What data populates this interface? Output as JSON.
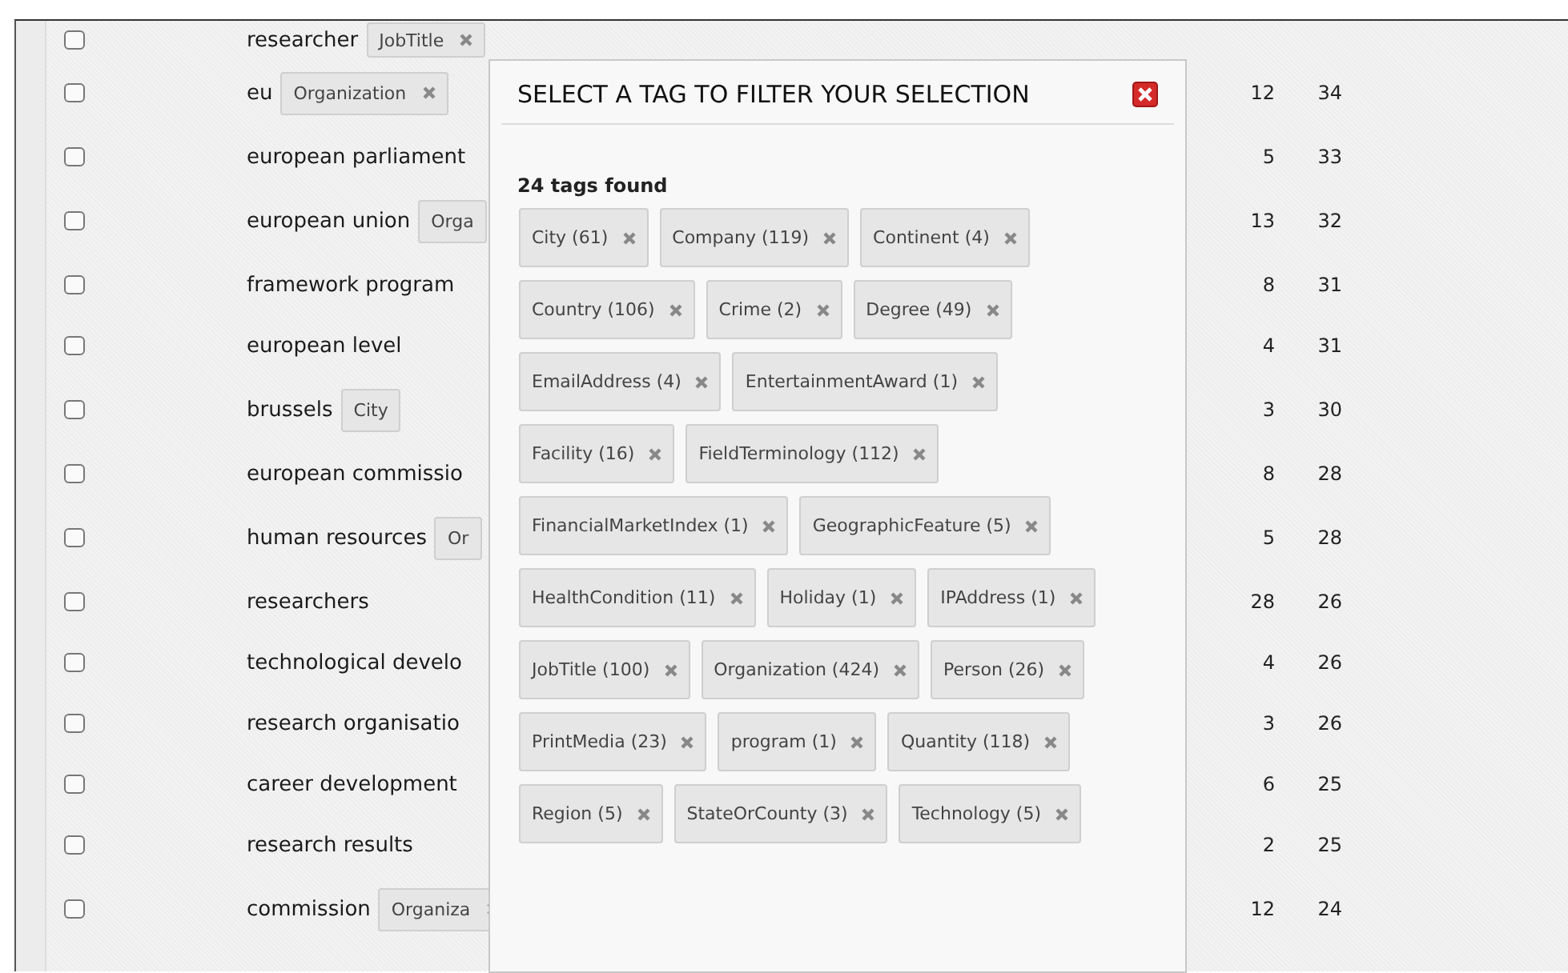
{
  "terms": [
    {
      "term": "researcher",
      "checked": false,
      "tags": [
        "JobTitle"
      ]
    },
    {
      "term": "eu",
      "checked": false,
      "tags": [
        "Organization"
      ],
      "count_1": "12",
      "count_2": "34"
    },
    {
      "term": "european parliament",
      "checked": false,
      "count_1": "5",
      "count_2": "33"
    },
    {
      "term": "european union",
      "checked": false,
      "tags": [
        "Orga"
      ],
      "count_1": "13",
      "count_2": "32"
    },
    {
      "term": "framework program",
      "checked": false,
      "count_1": "8",
      "count_2": "31"
    },
    {
      "term": "european level",
      "checked": false,
      "count_1": "4",
      "count_2": "31"
    },
    {
      "term": "brussels",
      "checked": false,
      "tags": [
        "City"
      ],
      "count_1": "3",
      "count_2": "30"
    },
    {
      "term": "european commissio",
      "checked": false,
      "count_1": "8",
      "count_2": "28"
    },
    {
      "term": "human resources",
      "checked": false,
      "tags": [
        "Or"
      ],
      "count_1": "5",
      "count_2": "28"
    },
    {
      "term": "researchers",
      "checked": false,
      "count_1": "28",
      "count_2": "26"
    },
    {
      "term": "technological develo",
      "checked": false,
      "count_1": "4",
      "count_2": "26"
    },
    {
      "term": "research organisatio",
      "checked": false,
      "count_1": "3",
      "count_2": "26"
    },
    {
      "term": "career development",
      "checked": false,
      "count_1": "6",
      "count_2": "25"
    },
    {
      "term": "research results",
      "checked": false,
      "count_1": "2",
      "count_2": "25"
    },
    {
      "term": "commission",
      "checked": false,
      "tags": [
        "Organiza"
      ],
      "count_1": "12",
      "count_2": "24"
    }
  ],
  "dialog": {
    "title": "SELECT A TAG TO FILTER YOUR SELECTION",
    "summary": "24 tags found",
    "tags": [
      "City (61)",
      "Company (119)",
      "Continent (4)",
      "Country (106)",
      "Crime (2)",
      "Degree (49)",
      "EmailAddress (4)",
      "EntertainmentAward (1)",
      "Facility (16)",
      "FieldTerminology (112)",
      "FinancialMarketIndex (1)",
      "GeographicFeature (5)",
      "HealthCondition (11)",
      "Holiday (1)",
      "IPAddress (1)",
      "JobTitle (100)",
      "Organization (424)",
      "Person (26)",
      "PrintMedia (23)",
      "program (1)",
      "Quantity (118)",
      "Region (5)",
      "StateOrCounty (3)",
      "Technology (5)"
    ]
  }
}
